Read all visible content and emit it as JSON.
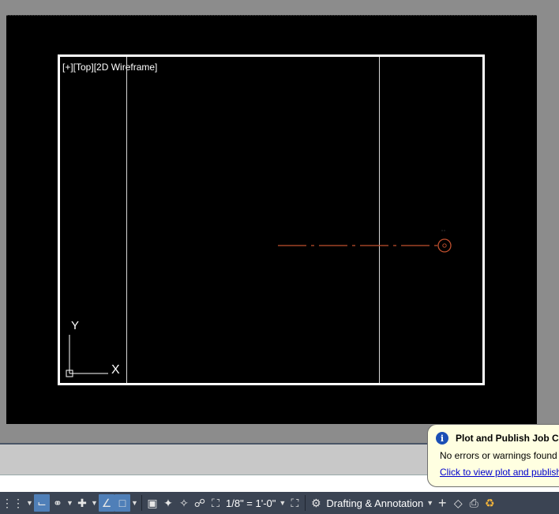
{
  "viewport": {
    "label": "[+][Top][2D Wireframe]",
    "ucs": {
      "y_label": "Y",
      "x_label": "X"
    },
    "colors": {
      "centerline": "#c1502e",
      "frame": "#ffffff",
      "background": "#000000"
    }
  },
  "status_bar": {
    "scale": "1/8\" = 1'-0\"",
    "workspace": "Drafting & Annotation",
    "icons": [
      "grid-icon",
      "ortho-icon",
      "polar-icon",
      "isodraft-icon",
      "osnap-tracking-icon",
      "osnap-icon",
      "select-cycling-icon",
      "annotation-visibility-icon",
      "autoscale-icon",
      "lock-ui-icon",
      "viewport-scale-icon",
      "maximize-viewport-icon",
      "gear-icon",
      "plus-icon",
      "isolate-objects-icon",
      "plot-icon",
      "plot-publish-status-icon"
    ]
  },
  "notification": {
    "title": "Plot and Publish Job Complete",
    "message": "No errors or warnings found",
    "link": "Click to view plot and publish details"
  }
}
